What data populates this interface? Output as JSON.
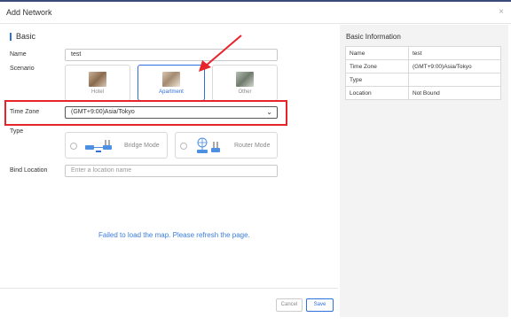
{
  "dialog": {
    "title": "Add Network",
    "close_icon": "×"
  },
  "basic": {
    "section_title": "Basic",
    "name_label": "Name",
    "name_value": "test",
    "scenario_label": "Scenario",
    "scenarios": [
      {
        "label": "Hotel",
        "selected": false
      },
      {
        "label": "Apartment",
        "selected": true
      },
      {
        "label": "Other",
        "selected": false
      }
    ],
    "timezone_label": "Time Zone",
    "timezone_value": "(GMT+9:00)Asia/Tokyo",
    "type_label": "Type",
    "types": [
      {
        "label": "Bridge Mode",
        "selected": false
      },
      {
        "label": "Router Mode",
        "selected": false
      }
    ],
    "bind_location_label": "Bind Location",
    "location_placeholder": "Enter a location name",
    "map_error": "Failed to load the map. Please refresh the page."
  },
  "buttons": {
    "cancel": "Cancel",
    "save": "Save"
  },
  "info": {
    "title": "Basic Information",
    "rows": [
      {
        "key": "Name",
        "value": "test"
      },
      {
        "key": "Time Zone",
        "value": "(GMT+9:00)Asia/Tokyo"
      },
      {
        "key": "Type",
        "value": ""
      },
      {
        "key": "Location",
        "value": "Not Bound"
      }
    ]
  },
  "colors": {
    "accent": "#2f6fde",
    "highlight": "#e8242b",
    "link": "#3b7ddd"
  }
}
